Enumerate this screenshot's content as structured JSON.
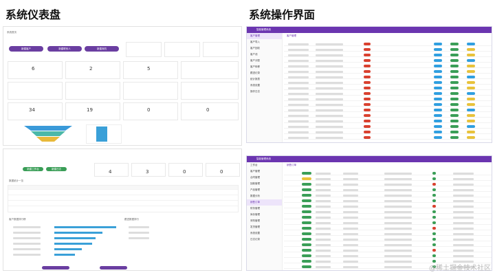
{
  "titles": {
    "dashboard": "系统仪表盘",
    "operations": "系统操作界面"
  },
  "watermark": "@稀土掘金技术社区",
  "colors": {
    "brand": "#6b35b0",
    "green": "#3a9e57",
    "blue": "#3aa0d8",
    "red": "#d9412f"
  },
  "dashboard_top": {
    "header_text": "系统首页",
    "buttons": [
      "新建客户",
      "新建联系人",
      "新建商机",
      "新建合同"
    ],
    "stat_numbers": [
      "6",
      "2",
      "5",
      "34",
      "19",
      "0",
      "0"
    ]
  },
  "dashboard_bottom": {
    "buttons": [
      "新建工作台",
      "新建日志"
    ],
    "stat_numbers": [
      "4",
      "3",
      "0",
      "0"
    ],
    "table_title": "数据统计一览",
    "list1_title": "客户数据排行榜",
    "list2_title": "跟进数据排行"
  },
  "ops_top": {
    "app_title": "智能管理系统",
    "tab": "客户管理",
    "sidebar": [
      "客户管理",
      "客户导入",
      "客户回收",
      "客户池",
      "客户分配",
      "客户转移",
      "跟进记录",
      "统计报表",
      "系统设置",
      "操作日志"
    ]
  },
  "ops_bottom": {
    "app_title": "智能管理系统",
    "tab": "销售订单",
    "sidebar": [
      "工作台",
      "客户管理",
      "合同管理",
      "回款管理",
      "产品管理",
      "数据分析",
      "销售订单",
      "财务管理",
      "库存管理",
      "采购管理",
      "发货管理",
      "系统设置",
      "日志记录"
    ]
  }
}
